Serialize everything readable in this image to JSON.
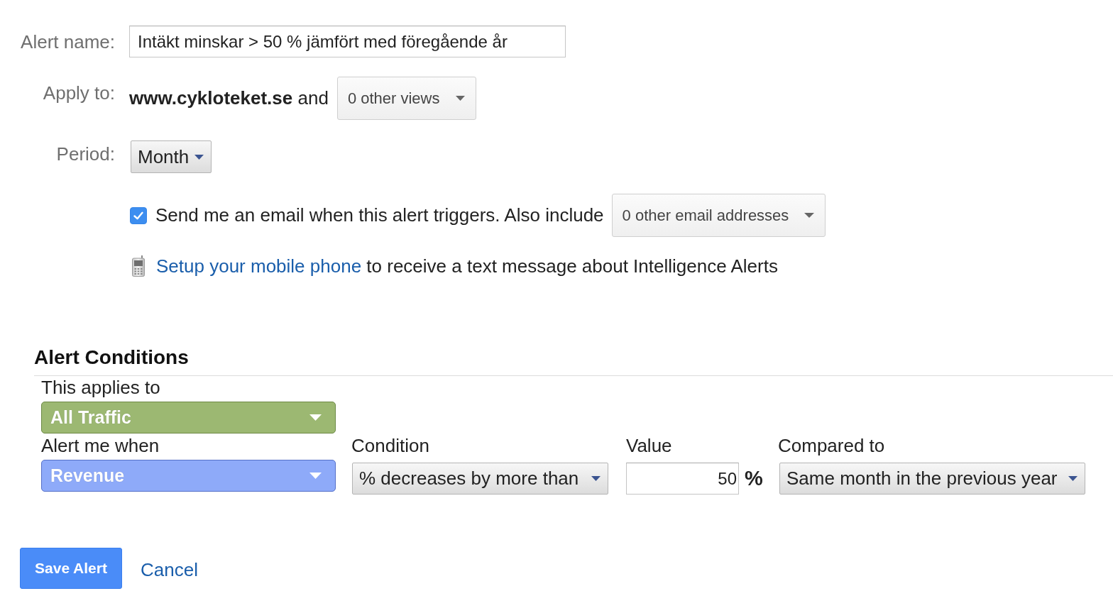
{
  "alert_form": {
    "name": {
      "label": "Alert name:",
      "value": "Intäkt minskar > 50 % jämfört med föregående år"
    },
    "apply_to": {
      "label": "Apply to:",
      "text": "**www.cykloteket.se** and",
      "views_dropdown": "0 other views"
    },
    "period": {
      "label": "Period:",
      "value": "Month"
    },
    "email": {
      "checked": true,
      "text": "Send me an email when this alert triggers. Also include",
      "addresses_dropdown": "0 other email addresses"
    },
    "mobile": {
      "link": "Setup your mobile phone",
      "text": "to receive a text message about Intelligence Alerts"
    }
  },
  "alert_conditions": {
    "title": "Alert Conditions",
    "applies_to": {
      "label": "This applies to",
      "value": "All Traffic"
    },
    "alert_me_when": {
      "label": "Alert me when",
      "value": "Revenue"
    },
    "condition": {
      "label": "Condition",
      "value": "% decreases by more than"
    },
    "value": {
      "label": "Value",
      "value": "50",
      "unit": "%"
    },
    "compared_to": {
      "label": "Compared to",
      "value": "Same month in the previous year"
    }
  },
  "actions": {
    "save": "Save Alert",
    "cancel": "Cancel"
  }
}
